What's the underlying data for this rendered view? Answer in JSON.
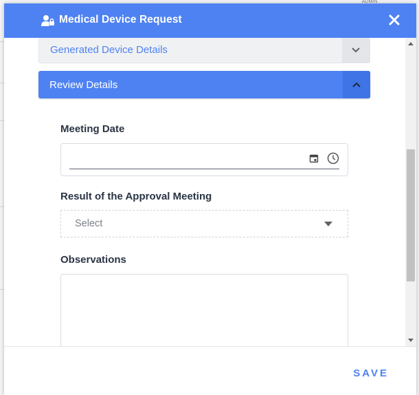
{
  "background": {
    "chip_text": "ADMIN"
  },
  "modal": {
    "title": "Medical Device Request",
    "header_icon": "user-lock-icon",
    "close_icon": "close-icon"
  },
  "accordions": [
    {
      "label": "Generated Device Details",
      "state": "collapsed",
      "icon": "chevron-down-icon"
    },
    {
      "label": "Review Details",
      "state": "expanded",
      "icon": "chevron-up-icon"
    }
  ],
  "form": {
    "meeting_date": {
      "label": "Meeting Date",
      "value": ""
    },
    "approval_result": {
      "label": "Result of the Approval Meeting",
      "selected": "Select"
    },
    "observations": {
      "label": "Observations",
      "value": ""
    }
  },
  "footer": {
    "save_label": "SAVE"
  },
  "colors": {
    "primary": "#4e82f2",
    "text": "#2a3444",
    "muted": "#7b8088"
  }
}
